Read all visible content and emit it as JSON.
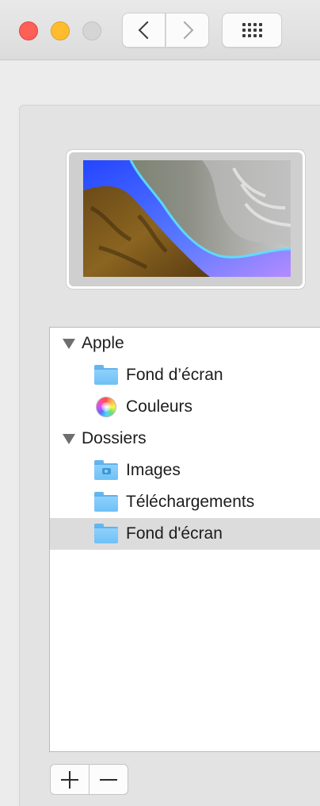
{
  "window": {
    "traffic_lights": {
      "close": "#fe5f57",
      "minimize": "#febc2e",
      "zoom": "#d5d5d5"
    },
    "toolbar": {
      "back_icon": "chevron-left-icon",
      "forward_icon": "chevron-right-icon",
      "grid_icon": "grid-icon"
    }
  },
  "sidebar": {
    "groups": [
      {
        "label": "Apple",
        "items": [
          {
            "label": "Fond d’écran",
            "icon": "folder-icon"
          },
          {
            "label": "Couleurs",
            "icon": "color-wheel-icon"
          }
        ]
      },
      {
        "label": "Dossiers",
        "items": [
          {
            "label": "Images",
            "icon": "pictures-folder-icon"
          },
          {
            "label": "Téléchargements",
            "icon": "folder-icon"
          },
          {
            "label": "Fond d'écran",
            "icon": "folder-icon",
            "selected": true
          }
        ]
      }
    ]
  },
  "buttons": {
    "add_icon": "plus-icon",
    "remove_icon": "minus-icon"
  }
}
